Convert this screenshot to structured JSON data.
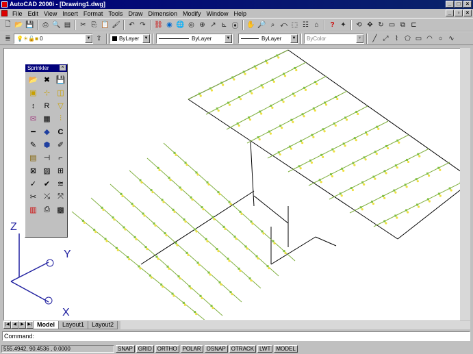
{
  "app": {
    "title": "AutoCAD 2000i - [Drawing1.dwg]"
  },
  "menu": [
    "File",
    "Edit",
    "View",
    "Insert",
    "Format",
    "Tools",
    "Draw",
    "Dimension",
    "Modify",
    "Window",
    "Help"
  ],
  "props": {
    "layer": "0",
    "color": "ByLayer",
    "linetype": "ByLayer",
    "lineweight": "ByLayer",
    "plotstyle": "ByColor"
  },
  "palette": {
    "title": "Sprinkler"
  },
  "tabs": [
    "Model",
    "Layout1",
    "Layout2"
  ],
  "command": {
    "prompt": "Command:"
  },
  "status": {
    "coords": "555.4942, 90.4536 , 0.0000",
    "toggles": [
      "SNAP",
      "GRID",
      "ORTHO",
      "POLAR",
      "OSNAP",
      "OTRACK",
      "LWT",
      "MODEL"
    ]
  },
  "ucs": {
    "z": "Z",
    "y": "Y",
    "x": "X"
  },
  "colors": {
    "sprinkler": "#f0e040",
    "fitting": "#80c040",
    "pipe": "#000000",
    "titlebar": "#00007a"
  }
}
